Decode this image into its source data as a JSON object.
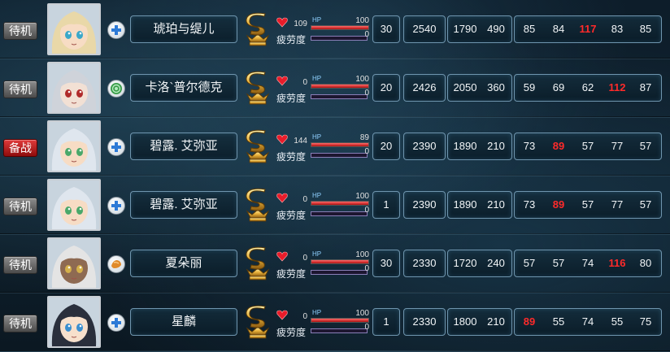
{
  "labels": {
    "hp_tag": "HP",
    "fatigue": "疲劳度"
  },
  "colors": {
    "highlight": "#ff2a2a",
    "hp_bar": "#e02020",
    "fatigue_bar": "#8a7fb8",
    "reserve_badge": "#c01818"
  },
  "rows": [
    {
      "status": "待机",
      "class_icon": "cross-icon",
      "name": "琥珀与缇儿",
      "rank": "S",
      "hp": "109",
      "hp_max": "100",
      "hp_fill": 1.0,
      "fatigue": "0",
      "level": "30",
      "power": "2540",
      "sub_a": "1790",
      "sub_b": "490",
      "stats": [
        "85",
        "84",
        "117",
        "83",
        "85"
      ],
      "stats_highlight": [
        false,
        false,
        true,
        false,
        false
      ]
    },
    {
      "status": "待机",
      "class_icon": "swirl-icon",
      "name": "卡洛`普尔德克",
      "rank": "S",
      "hp": "0",
      "hp_max": "100",
      "hp_fill": 1.0,
      "fatigue": "0",
      "level": "20",
      "power": "2426",
      "sub_a": "2050",
      "sub_b": "360",
      "stats": [
        "59",
        "69",
        "62",
        "112",
        "87"
      ],
      "stats_highlight": [
        false,
        false,
        false,
        true,
        false
      ]
    },
    {
      "status": "备战",
      "class_icon": "cross-icon",
      "name": "碧露. 艾弥亚",
      "rank": "S",
      "hp": "144",
      "hp_max": "89",
      "hp_fill": 1.0,
      "fatigue": "0",
      "level": "20",
      "power": "2390",
      "sub_a": "1890",
      "sub_b": "210",
      "stats": [
        "73",
        "89",
        "57",
        "77",
        "57"
      ],
      "stats_highlight": [
        false,
        true,
        false,
        false,
        false
      ]
    },
    {
      "status": "待机",
      "class_icon": "cross-icon",
      "name": "碧露. 艾弥亚",
      "rank": "S",
      "hp": "0",
      "hp_max": "100",
      "hp_fill": 1.0,
      "fatigue": "0",
      "level": "1",
      "power": "2390",
      "sub_a": "1890",
      "sub_b": "210",
      "stats": [
        "73",
        "89",
        "57",
        "77",
        "57"
      ],
      "stats_highlight": [
        false,
        true,
        false,
        false,
        false
      ]
    },
    {
      "status": "待机",
      "class_icon": "shell-icon",
      "name": "夏朵丽",
      "rank": "S",
      "hp": "0",
      "hp_max": "100",
      "hp_fill": 1.0,
      "fatigue": "0",
      "level": "30",
      "power": "2330",
      "sub_a": "1720",
      "sub_b": "240",
      "stats": [
        "57",
        "57",
        "74",
        "116",
        "80"
      ],
      "stats_highlight": [
        false,
        false,
        false,
        true,
        false
      ]
    },
    {
      "status": "待机",
      "class_icon": "cross-icon",
      "name": "星麟",
      "rank": "S",
      "hp": "0",
      "hp_max": "100",
      "hp_fill": 1.0,
      "fatigue": "0",
      "level": "1",
      "power": "2330",
      "sub_a": "1800",
      "sub_b": "210",
      "stats": [
        "89",
        "55",
        "74",
        "55",
        "75"
      ],
      "stats_highlight": [
        true,
        false,
        false,
        false,
        false
      ]
    }
  ]
}
